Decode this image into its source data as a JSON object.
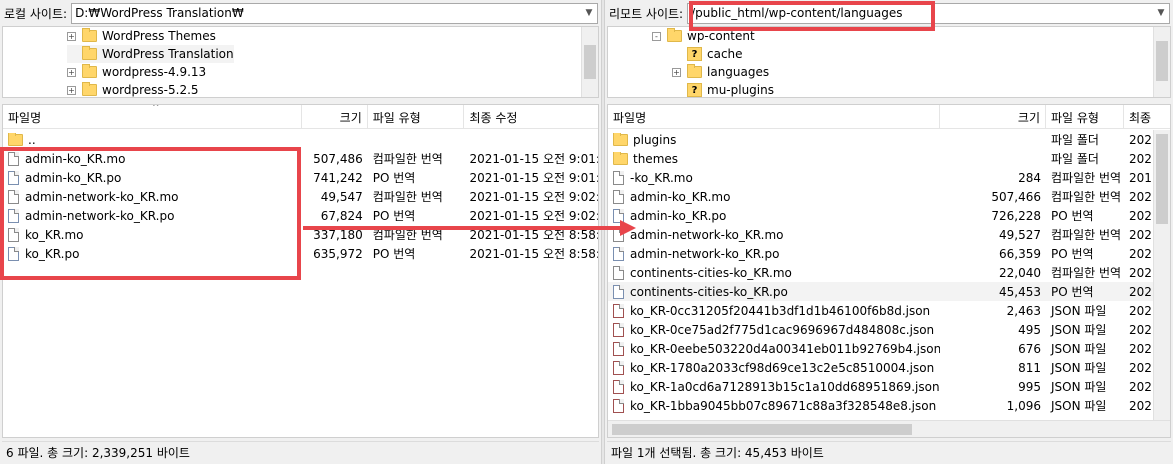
{
  "left": {
    "path_label": "로컬 사이트:",
    "path_value": "D:₩WordPress Translation₩",
    "tree": [
      {
        "label": "WordPress Themes",
        "expander": "+",
        "selected": false
      },
      {
        "label": "WordPress Translation",
        "expander": "",
        "selected": true
      },
      {
        "label": "wordpress-4.9.13",
        "expander": "+",
        "selected": false
      },
      {
        "label": "wordpress-5.2.5",
        "expander": "+",
        "selected": false
      }
    ],
    "columns": {
      "name": "파일명",
      "size": "크기",
      "type": "파일 유형",
      "modified": "최종 수정"
    },
    "files": [
      {
        "name": "..",
        "size": "",
        "type": "",
        "modified": "",
        "icon": "folder-icon"
      },
      {
        "name": "admin-ko_KR.mo",
        "size": "507,486",
        "type": "컴파일한 번역",
        "modified": "2021-01-15 오전 9:01:",
        "icon": "file-icon"
      },
      {
        "name": "admin-ko_KR.po",
        "size": "741,242",
        "type": "PO 번역",
        "modified": "2021-01-15 오전 9:01:",
        "icon": "po-file-icon"
      },
      {
        "name": "admin-network-ko_KR.mo",
        "size": "49,547",
        "type": "컴파일한 번역",
        "modified": "2021-01-15 오전 9:02:",
        "icon": "file-icon"
      },
      {
        "name": "admin-network-ko_KR.po",
        "size": "67,824",
        "type": "PO 번역",
        "modified": "2021-01-15 오전 9:02:",
        "icon": "po-file-icon"
      },
      {
        "name": "ko_KR.mo",
        "size": "337,180",
        "type": "컴파일한 번역",
        "modified": "2021-01-15 오전 8:58:",
        "icon": "file-icon"
      },
      {
        "name": "ko_KR.po",
        "size": "635,972",
        "type": "PO 번역",
        "modified": "2021-01-15 오전 8:58:",
        "icon": "po-file-icon"
      }
    ],
    "status": "6 파일. 총 크기: 2,339,251 바이트"
  },
  "right": {
    "path_label": "리모트 사이트:",
    "path_value": "/public_html/wp-content/languages",
    "tree": [
      {
        "label": "wp-content",
        "expander": "-",
        "icon": "folder-icon"
      },
      {
        "label": "cache",
        "expander": "",
        "icon": "unknown-folder-icon"
      },
      {
        "label": "languages",
        "expander": "+",
        "icon": "folder-icon"
      },
      {
        "label": "mu-plugins",
        "expander": "",
        "icon": "unknown-folder-icon"
      }
    ],
    "columns": {
      "name": "파일명",
      "size": "크기",
      "type": "파일 유형",
      "modified": "최종"
    },
    "files": [
      {
        "name": "plugins",
        "size": "",
        "type": "파일 폴더",
        "modified": "202",
        "icon": "folder-icon"
      },
      {
        "name": "themes",
        "size": "",
        "type": "파일 폴더",
        "modified": "202",
        "icon": "folder-icon"
      },
      {
        "name": "-ko_KR.mo",
        "size": "284",
        "type": "컴파일한 번역",
        "modified": "201",
        "icon": "file-icon"
      },
      {
        "name": "admin-ko_KR.mo",
        "size": "507,466",
        "type": "컴파일한 번역",
        "modified": "202",
        "icon": "file-icon"
      },
      {
        "name": "admin-ko_KR.po",
        "size": "726,228",
        "type": "PO 번역",
        "modified": "202",
        "icon": "po-file-icon"
      },
      {
        "name": "admin-network-ko_KR.mo",
        "size": "49,527",
        "type": "컴파일한 번역",
        "modified": "202",
        "icon": "file-icon"
      },
      {
        "name": "admin-network-ko_KR.po",
        "size": "66,359",
        "type": "PO 번역",
        "modified": "202",
        "icon": "po-file-icon"
      },
      {
        "name": "continents-cities-ko_KR.mo",
        "size": "22,040",
        "type": "컴파일한 번역",
        "modified": "202",
        "icon": "file-icon"
      },
      {
        "name": "continents-cities-ko_KR.po",
        "size": "45,453",
        "type": "PO 번역",
        "modified": "202",
        "icon": "po-file-icon",
        "selected": true
      },
      {
        "name": "ko_KR-0cc31205f20441b3df1d1b46100f6b8d.json",
        "size": "2,463",
        "type": "JSON 파일",
        "modified": "202",
        "icon": "json-file-icon"
      },
      {
        "name": "ko_KR-0ce75ad2f775d1cac9696967d484808c.json",
        "size": "495",
        "type": "JSON 파일",
        "modified": "202",
        "icon": "json-file-icon"
      },
      {
        "name": "ko_KR-0eebe503220d4a00341eb011b92769b4.json",
        "size": "676",
        "type": "JSON 파일",
        "modified": "202",
        "icon": "json-file-icon"
      },
      {
        "name": "ko_KR-1780a2033cf98d69ce13c2e5c8510004.json",
        "size": "811",
        "type": "JSON 파일",
        "modified": "202",
        "icon": "json-file-icon"
      },
      {
        "name": "ko_KR-1a0cd6a7128913b15c1a10dd68951869.json",
        "size": "995",
        "type": "JSON 파일",
        "modified": "202",
        "icon": "json-file-icon"
      },
      {
        "name": "ko_KR-1bba9045bb07c89671c88a3f328548e8.json",
        "size": "1,096",
        "type": "JSON 파일",
        "modified": "202",
        "icon": "json-file-icon"
      }
    ],
    "status": "파일 1개 선택됨. 총 크기: 45,453 바이트"
  },
  "colors": {
    "highlight": "#e8454b"
  }
}
